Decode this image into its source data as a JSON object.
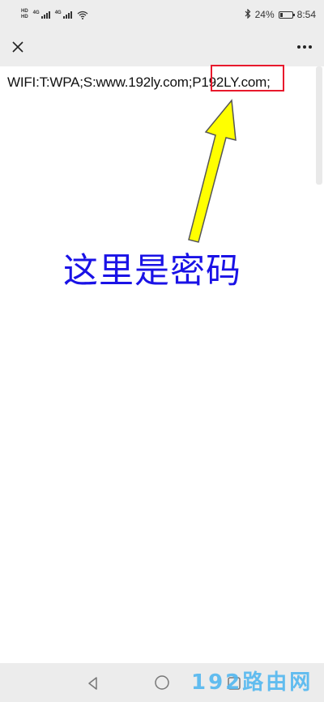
{
  "statusbar": {
    "hd1": "HD",
    "hd2": "HD",
    "net1": "4G",
    "net2": "4G",
    "battery_percent": "24%",
    "battery_level": 0.24,
    "time": "8:54"
  },
  "icons": {
    "close": "close-icon",
    "more": "more-icon",
    "bluetooth": "bluetooth-icon",
    "wifi": "wifi-icon",
    "back": "back-icon",
    "home": "home-icon",
    "recent": "recent-apps-icon"
  },
  "content": {
    "wifi_prefix": "WIFI:T:WPA;S:www.192ly.com;P",
    "wifi_password": "192LY.com",
    "wifi_suffix": ";"
  },
  "annotation": {
    "caption": "这里是密码",
    "box_color": "#e8192c",
    "arrow_color": "#ffff00",
    "caption_color": "#1a12e6"
  },
  "watermark": {
    "text": "192路由网",
    "color": "#53b7f0"
  }
}
